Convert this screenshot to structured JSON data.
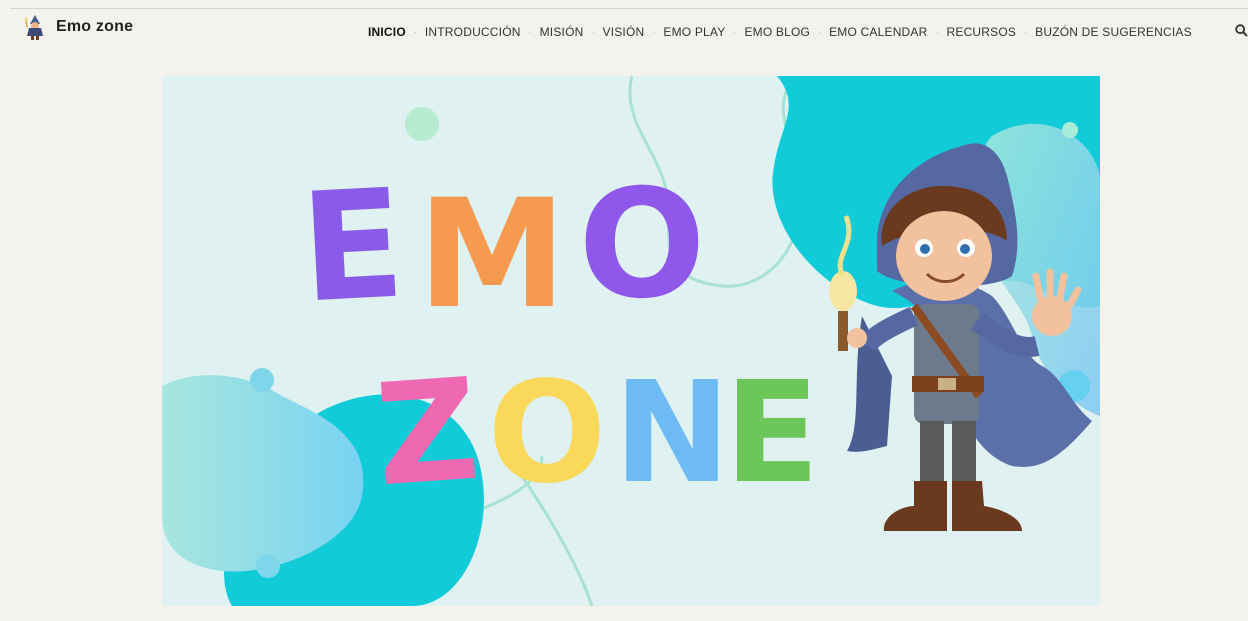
{
  "site": {
    "name": "Emo zone"
  },
  "nav": {
    "items": [
      {
        "label": "INICIO",
        "active": true
      },
      {
        "label": "INTRODUCCIÓN",
        "active": false
      },
      {
        "label": "MISIÓN",
        "active": false
      },
      {
        "label": "VISIÓN",
        "active": false
      },
      {
        "label": "EMO PLAY",
        "active": false
      },
      {
        "label": "EMO BLOG",
        "active": false
      },
      {
        "label": "EMO CALENDAR",
        "active": false
      },
      {
        "label": "RECURSOS",
        "active": false
      },
      {
        "label": "BUZÓN DE SUGERENCIAS",
        "active": false
      }
    ],
    "search_icon": "search-icon"
  },
  "hero": {
    "title_line1": [
      "E",
      "M",
      "O"
    ],
    "title_line2": [
      "Z",
      "O",
      "N",
      "E"
    ],
    "letter_colors": {
      "E1": "#8a5be8",
      "M": "#f59a4f",
      "O1": "#8f57ea",
      "Z": "#ee68b2",
      "O2": "#f9d85a",
      "N": "#6dbaf5",
      "E2": "#6cc65a"
    },
    "accent_color": "#12c8d8",
    "character": "boy-wizard-with-torch"
  }
}
